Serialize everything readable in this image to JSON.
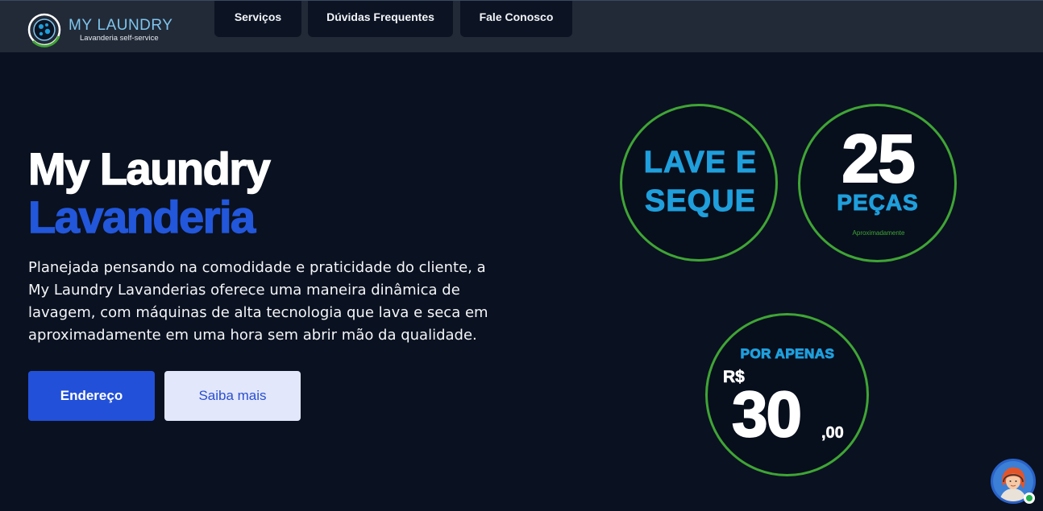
{
  "header": {
    "logo_title_accent": "MY",
    "logo_title_main": "LAUNDRY",
    "logo_subtitle": "Lavanderia self-service",
    "nav": [
      {
        "label": "Serviços"
      },
      {
        "label": "Dúvidas Frequentes"
      },
      {
        "label": "Fale Conosco"
      }
    ]
  },
  "hero": {
    "title_line1": "My Laundry",
    "title_line2": "Lavanderia",
    "description": "Planejada pensando na comodidade e praticidade do cliente, a My Laundry Lavanderias oferece uma maneira dinâmica de lavagem, com máquinas de alta tecnologia que lava e seca em aproximadamente em uma hora sem abrir mão da qualidade.",
    "primary_button": "Endereço",
    "secondary_button": "Saiba mais"
  },
  "badges": {
    "wash_dry_line1": "LAVE E",
    "wash_dry_line2": "SEQUE",
    "pieces_number": "25",
    "pieces_label": "PEÇAS",
    "pieces_note": "Aproximadamente",
    "price_intro": "POR APENAS",
    "price_currency": "R$",
    "price_whole": "30",
    "price_cents": ",00"
  },
  "colors": {
    "accent_blue": "#2250d9",
    "badge_green": "#3fa535",
    "badge_blue": "#1f9fdc",
    "background": "#0a1120"
  },
  "chat_widget": {
    "icon": "support-agent-avatar-icon",
    "status": "online"
  }
}
